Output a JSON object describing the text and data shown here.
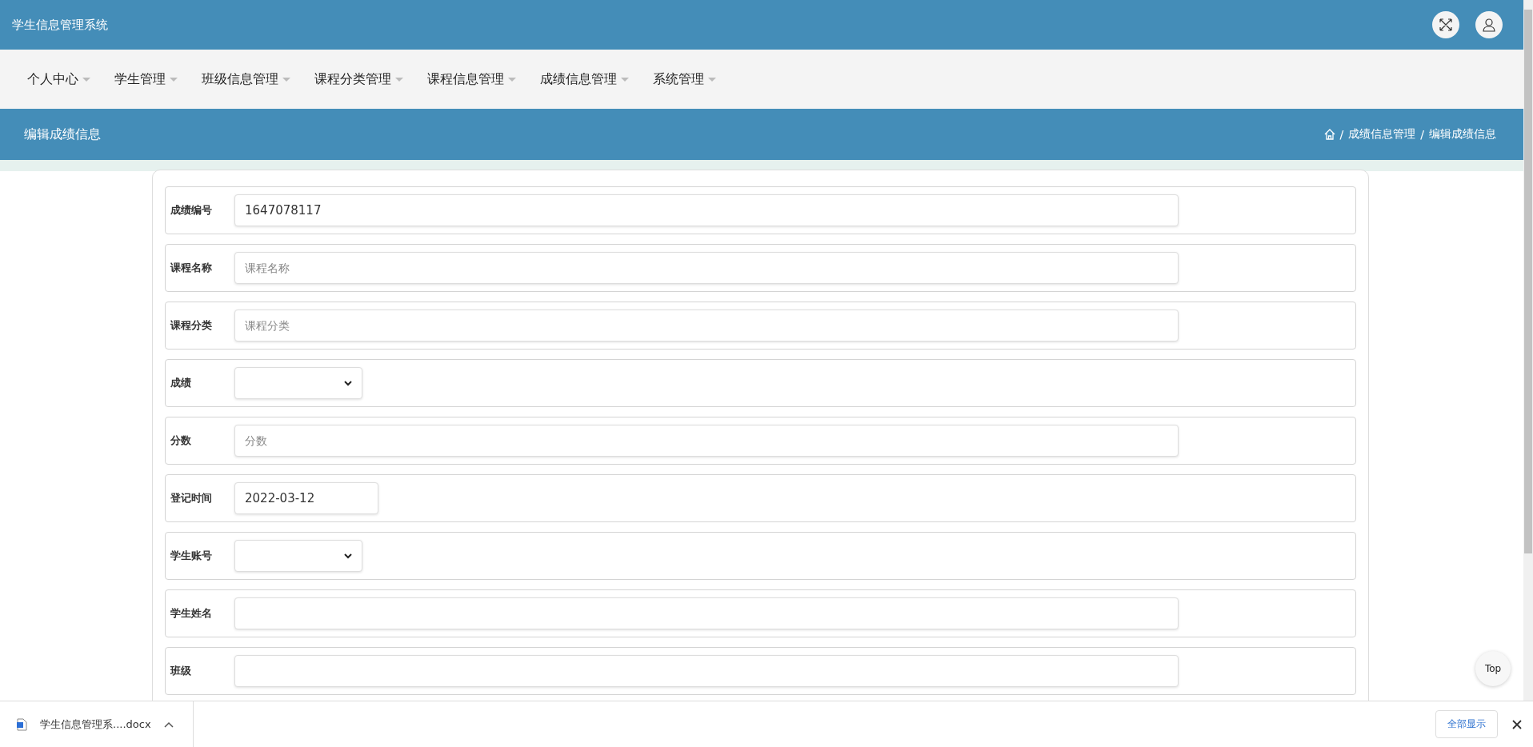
{
  "header": {
    "title": "学生信息管理系统"
  },
  "nav": {
    "items": [
      {
        "label": "个人中心"
      },
      {
        "label": "学生管理"
      },
      {
        "label": "班级信息管理"
      },
      {
        "label": "课程分类管理"
      },
      {
        "label": "课程信息管理"
      },
      {
        "label": "成绩信息管理"
      },
      {
        "label": "系统管理"
      }
    ]
  },
  "page_title": "编辑成绩信息",
  "breadcrumb": {
    "separator": "/",
    "items": [
      "成绩信息管理",
      "编辑成绩信息"
    ]
  },
  "form": {
    "fields": [
      {
        "label": "成绩编号",
        "kind": "text",
        "value": "1647078117"
      },
      {
        "label": "课程名称",
        "kind": "text",
        "placeholder": "课程名称"
      },
      {
        "label": "课程分类",
        "kind": "text",
        "placeholder": "课程分类"
      },
      {
        "label": "成绩",
        "kind": "select"
      },
      {
        "label": "分数",
        "kind": "text",
        "placeholder": "分数"
      },
      {
        "label": "登记时间",
        "kind": "date",
        "value": "2022-03-12"
      },
      {
        "label": "学生账号",
        "kind": "select"
      },
      {
        "label": "学生姓名",
        "kind": "text"
      },
      {
        "label": "班级",
        "kind": "text"
      }
    ]
  },
  "top_button": "Top",
  "download_bar": {
    "file": "学生信息管理系....docx",
    "show_all": "全部显示"
  }
}
